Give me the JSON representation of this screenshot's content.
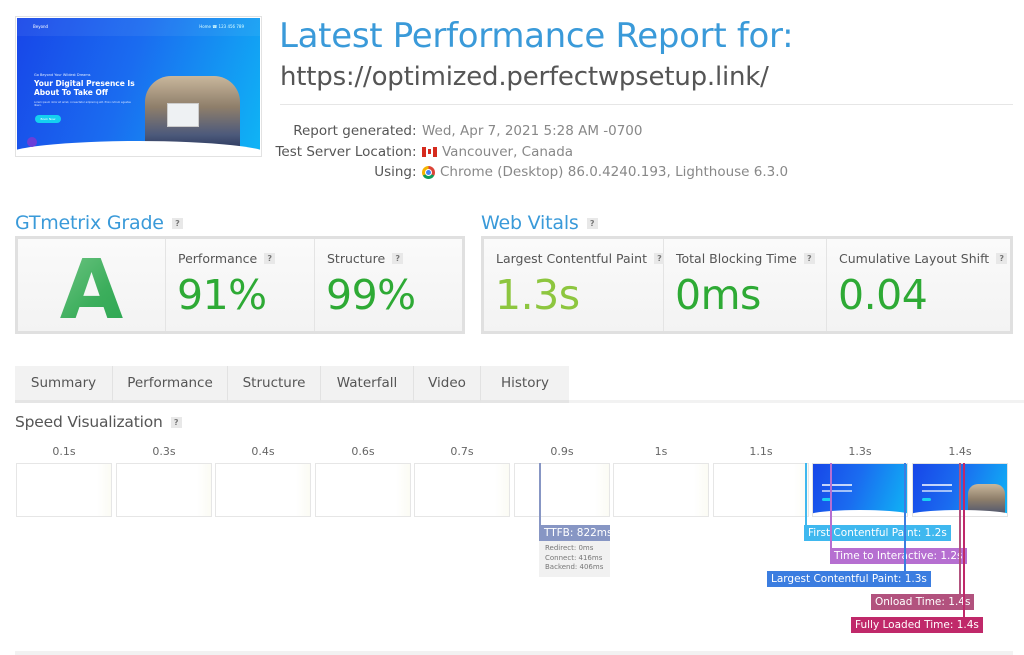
{
  "thumbnail": {
    "logo": "Beyond",
    "nav_links": "Home   ☎ 123 456 789",
    "subheading": "Go Beyond Your Wildest Dreams",
    "headline": "Your Digital Presence Is About To Take Off",
    "body": "Lorem ipsum dolor sit amet, consectetur adipiscing elit. Proin rutrum egestas libero.",
    "button": "Book Now"
  },
  "header": {
    "title": "Latest Performance Report for:",
    "url": "https://optimized.perfectwpsetup.link/"
  },
  "meta": [
    {
      "label": "Report generated",
      "value": "Wed, Apr 7, 2021 5:28 AM -0700",
      "icon": ""
    },
    {
      "label": "Test Server Location",
      "value": "Vancouver, Canada",
      "icon": "canada-flag-icon"
    },
    {
      "label": "Using",
      "value": "Chrome (Desktop) 86.0.4240.193, Lighthouse 6.3.0",
      "icon": "chrome-icon"
    }
  ],
  "gtmetrix": {
    "heading": "GTmetrix Grade",
    "help": "?",
    "grade": "A",
    "performance_label": "Performance",
    "performance_value": "91%",
    "structure_label": "Structure",
    "structure_value": "99%",
    "value_color": "#2eaa35"
  },
  "web_vitals": {
    "heading": "Web Vitals",
    "help": "?",
    "lcp_label": "Largest Contentful Paint",
    "lcp_value": "1.3s",
    "lcp_color": "#8dc63f",
    "tbt_label": "Total Blocking Time",
    "tbt_value": "0ms",
    "cls_label": "Cumulative Layout Shift",
    "cls_value": "0.04",
    "good_color": "#2eaa35"
  },
  "tabs": [
    {
      "label": "Summary",
      "active": true
    },
    {
      "label": "Performance",
      "active": false
    },
    {
      "label": "Structure",
      "active": false
    },
    {
      "label": "Waterfall",
      "active": false
    },
    {
      "label": "Video",
      "active": false
    },
    {
      "label": "History",
      "active": false
    }
  ],
  "speed_viz": {
    "heading": "Speed Visualization",
    "help": "?",
    "frames": [
      {
        "time": "0.1s",
        "rendered": false
      },
      {
        "time": "0.3s",
        "rendered": false
      },
      {
        "time": "0.4s",
        "rendered": false
      },
      {
        "time": "0.6s",
        "rendered": false
      },
      {
        "time": "0.7s",
        "rendered": false
      },
      {
        "time": "0.9s",
        "rendered": false
      },
      {
        "time": "1s",
        "rendered": false
      },
      {
        "time": "1.1s",
        "rendered": false
      },
      {
        "time": "1.3s",
        "rendered": true,
        "photo": false
      },
      {
        "time": "1.4s",
        "rendered": true,
        "photo": true
      }
    ],
    "markers": [
      {
        "id": "ttfb",
        "label": "TTFB: 822ms",
        "color": "#8796c4"
      },
      {
        "id": "fcp",
        "label": "First Contentful Paint: 1.2s",
        "color": "#3fb8ef"
      },
      {
        "id": "tti",
        "label": "Time to Interactive: 1.2s",
        "color": "#b66fd1"
      },
      {
        "id": "lcp",
        "label": "Largest Contentful Paint: 1.3s",
        "color": "#3b7de0"
      },
      {
        "id": "onload",
        "label": "Onload Time: 1.4s",
        "color": "#b2527e"
      },
      {
        "id": "fully",
        "label": "Fully Loaded Time: 1.4s",
        "color": "#c0296a"
      }
    ],
    "ttfb_breakdown": [
      "Redirect: 0ms",
      "Connect: 416ms",
      "Backend: 406ms"
    ]
  }
}
